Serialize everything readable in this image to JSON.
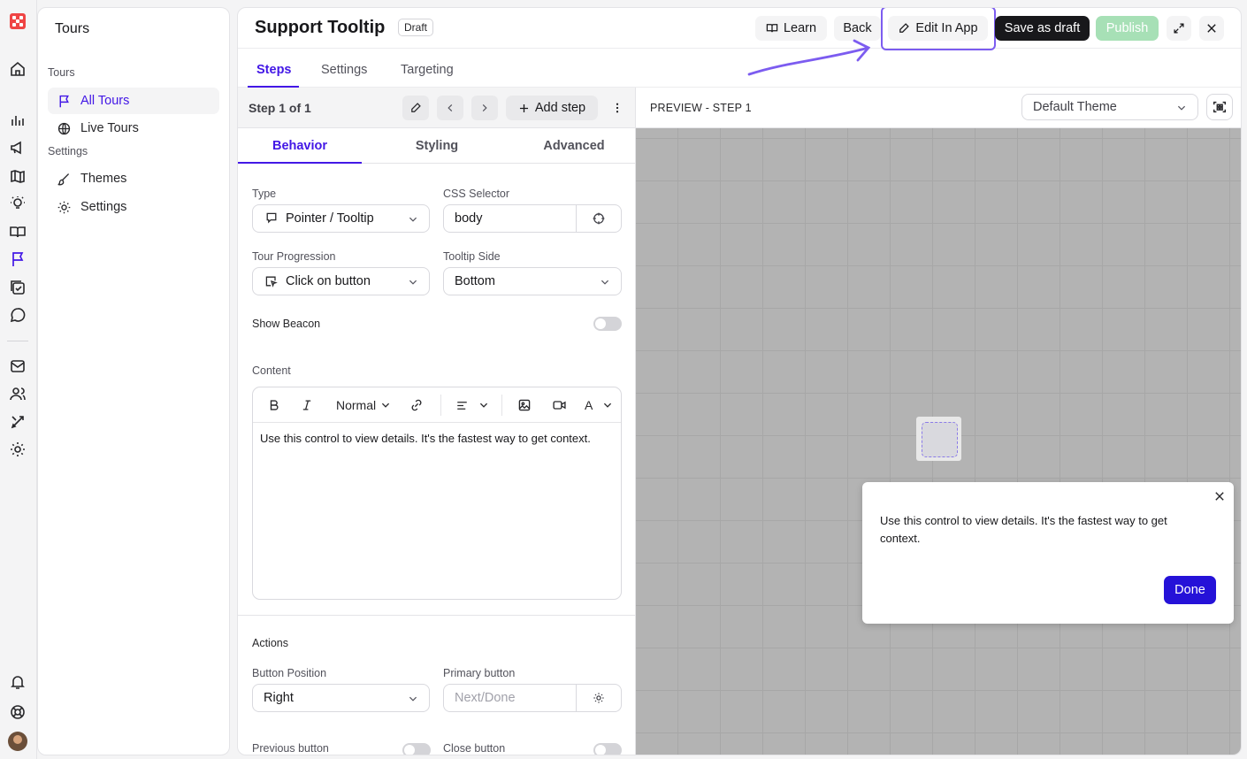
{
  "rail": {
    "icons": [
      "home-icon",
      "chart-icon",
      "megaphone-icon",
      "map-icon",
      "lightbulb-icon",
      "book-icon",
      "flag-icon",
      "checklist-icon",
      "chat-icon",
      "mail-icon",
      "users-icon",
      "tools-icon",
      "gear-icon",
      "bell-icon",
      "help-icon"
    ]
  },
  "sidebar": {
    "title": "Tours",
    "section_tours": "Tours",
    "section_settings": "Settings",
    "items": [
      {
        "label": "All Tours",
        "icon": "flag-icon",
        "active": true
      },
      {
        "label": "Live Tours",
        "icon": "globe-icon",
        "active": false
      },
      {
        "label": "Themes",
        "icon": "brush-icon",
        "active": false
      },
      {
        "label": "Settings",
        "icon": "gear-icon",
        "active": false
      }
    ]
  },
  "header": {
    "title": "Support Tooltip",
    "status_badge": "Draft",
    "learn_label": "Learn",
    "back_label": "Back",
    "edit_in_app_label": "Edit In App",
    "save_draft_label": "Save as draft",
    "publish_label": "Publish"
  },
  "tabs": [
    "Steps",
    "Settings",
    "Targeting"
  ],
  "stepbar": {
    "label": "Step 1 of 1",
    "add_step_label": "Add step"
  },
  "subtabs": [
    "Behavior",
    "Styling",
    "Advanced"
  ],
  "form": {
    "type_label": "Type",
    "type_value": "Pointer / Tooltip",
    "css_selector_label": "CSS Selector",
    "css_selector_value": "body",
    "progression_label": "Tour Progression",
    "progression_value": "Click on button",
    "tooltip_side_label": "Tooltip Side",
    "tooltip_side_value": "Bottom",
    "show_beacon_label": "Show Beacon",
    "show_beacon": false,
    "content_label": "Content",
    "content_format": "Normal",
    "content_text": "Use this control to view details. It's the fastest way to get context.",
    "font_tool": "A",
    "actions_label": "Actions",
    "button_position_label": "Button Position",
    "button_position_value": "Right",
    "primary_button_label": "Primary button",
    "primary_button_placeholder": "Next/Done",
    "previous_button_label": "Previous button",
    "previous_button": false,
    "close_button_label": "Close button",
    "close_button": false
  },
  "preview": {
    "title": "PREVIEW - STEP 1",
    "theme_value": "Default Theme",
    "tooltip_text": "Use this control to view details. It's the fastest way to get context.",
    "done_label": "Done"
  },
  "colors": {
    "accent": "#4318e6",
    "done_button": "#2512d8",
    "publish_disabled": "#a7e0b6",
    "highlight": "#7c5cf0"
  }
}
